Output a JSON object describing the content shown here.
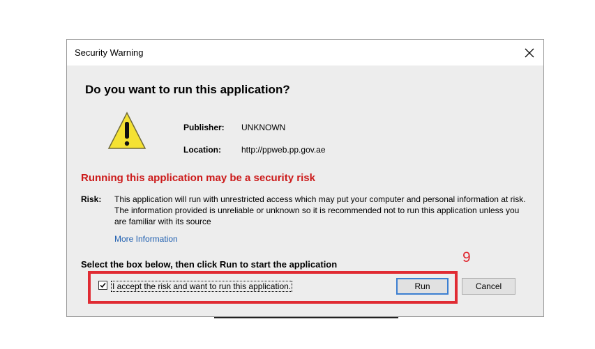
{
  "window": {
    "title": "Security Warning"
  },
  "dialog": {
    "heading": "Do you want to run this application?",
    "publisher_label": "Publisher:",
    "publisher_value": "UNKNOWN",
    "location_label": "Location:",
    "location_value": "http://ppweb.pp.gov.ae",
    "risk_heading": "Running this application may be a security risk",
    "risk_label": "Risk:",
    "risk_text": "This application will run with unrestricted access which may put your computer and personal information at risk. The information provided is unreliable or unknown so it is recommended not to run this application unless you are familiar with its source",
    "more_info": "More Information",
    "instruction": "Select the box below, then click Run to start the application",
    "checkbox_label": "I accept the risk and want to run this application.",
    "checkbox_checked": true,
    "run_label": "Run",
    "cancel_label": "Cancel"
  },
  "annotation": {
    "step_number": "9",
    "color": "#e02b33"
  },
  "icons": {
    "warning": "warning-triangle-icon",
    "close": "close-icon",
    "check": "checkmark-icon"
  },
  "colors": {
    "risk_heading": "#cc1a1a",
    "link": "#1f5fb0",
    "dialog_bg": "#ededed"
  }
}
